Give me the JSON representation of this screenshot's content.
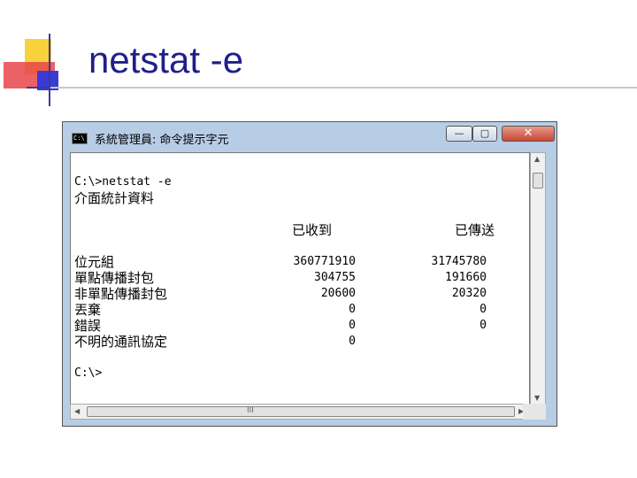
{
  "slide": {
    "title": "netstat -e"
  },
  "window": {
    "title": "系統管理員: 命令提示字元",
    "icon_label": "C:\\",
    "minimize_glyph": "—",
    "maximize_glyph": "▢",
    "close_glyph": "✕"
  },
  "console": {
    "command": "C:\\>netstat -e",
    "header": "介面統計資料",
    "col_received": "已收到",
    "col_sent": "已傳送",
    "rows": [
      {
        "label": "位元組",
        "received": "360771910",
        "sent": "31745780"
      },
      {
        "label": "單點傳播封包",
        "received": "304755",
        "sent": "191660"
      },
      {
        "label": "非單點傳播封包",
        "received": "20600",
        "sent": "20320"
      },
      {
        "label": "丟棄",
        "received": "0",
        "sent": "0"
      },
      {
        "label": "錯誤",
        "received": "0",
        "sent": "0"
      },
      {
        "label": "不明的通訊協定",
        "received": "0",
        "sent": ""
      }
    ],
    "prompt": "C:\\>"
  },
  "scrollbar": {
    "grip_glyph": "III"
  }
}
